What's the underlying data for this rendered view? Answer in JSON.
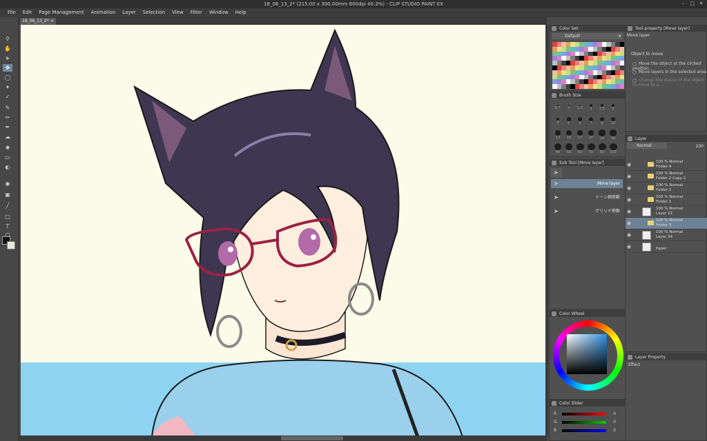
{
  "window": {
    "title": "18_06_13_2* (215.00 x 300.00mm 600dpi 40.3%) - CLIP STUDIO PAINT EX"
  },
  "menu": [
    "File",
    "Edit",
    "Page Management",
    "Animation",
    "Layer",
    "Selection",
    "View",
    "Filter",
    "Window",
    "Help"
  ],
  "document": {
    "tab": "18_06_13_2*"
  },
  "panels": {
    "color_set": {
      "title": "Color Set",
      "preset": "Default"
    },
    "brush_size": {
      "title": "Brush Size",
      "sizes": [
        "0.7",
        "1",
        "1.5",
        "2",
        "2.5",
        "3",
        "4",
        "5",
        "6",
        "7",
        "8",
        "10",
        "12",
        "15",
        "17",
        "20",
        "25",
        "30",
        "40",
        "50",
        "60",
        "70",
        "80",
        "100"
      ]
    },
    "sub_tool": {
      "title": "Sub Tool [Move layer]",
      "items": [
        "Move layer",
        "トーン柄移動",
        "グリッド移動"
      ],
      "selected": "Move layer"
    },
    "tool_property": {
      "title": "Tool property [Move layer]",
      "tool_name": "Move layer",
      "object_label": "Object to move",
      "options": [
        "Move the object at the clicked position",
        "Move layers in the selected area",
        "Change the status of the object to move to a..."
      ]
    },
    "layer": {
      "title": "Layer",
      "blend_mode": "Normal",
      "opacity": "100",
      "layers": [
        {
          "opacity": "100 % Normal",
          "name": "Folder 4",
          "type": "folder"
        },
        {
          "opacity": "100 % Normal",
          "name": "Folder 2 Copy 2",
          "type": "folder"
        },
        {
          "opacity": "100 % Normal",
          "name": "Folder 2",
          "type": "folder"
        },
        {
          "opacity": "100 % Normal",
          "name": "Folder 1",
          "type": "folder"
        },
        {
          "opacity": "100 % Normal",
          "name": "Layer 22",
          "type": "raster"
        },
        {
          "opacity": "100 % Normal",
          "name": "Folder 3",
          "type": "folder",
          "selected": true
        },
        {
          "opacity": "100 % Normal",
          "name": "Layer 34",
          "type": "raster"
        },
        {
          "opacity": "",
          "name": "Paper",
          "type": "paper"
        }
      ]
    },
    "color_wheel": {
      "title": "Color Wheel"
    },
    "color_slider": {
      "title": "Color Slider",
      "rgb": [
        {
          "label": "R",
          "value": "0"
        },
        {
          "label": "G",
          "value": "0"
        },
        {
          "label": "B",
          "value": "0"
        }
      ]
    },
    "layer_property": {
      "title": "Layer Property",
      "effect_label": "Effect"
    }
  },
  "colors": {
    "fg": "#111111",
    "bg": "#e9e9d8",
    "accent": "#6e8296",
    "canvas": "#fbfbe9",
    "sky": "#8fd3f2"
  }
}
